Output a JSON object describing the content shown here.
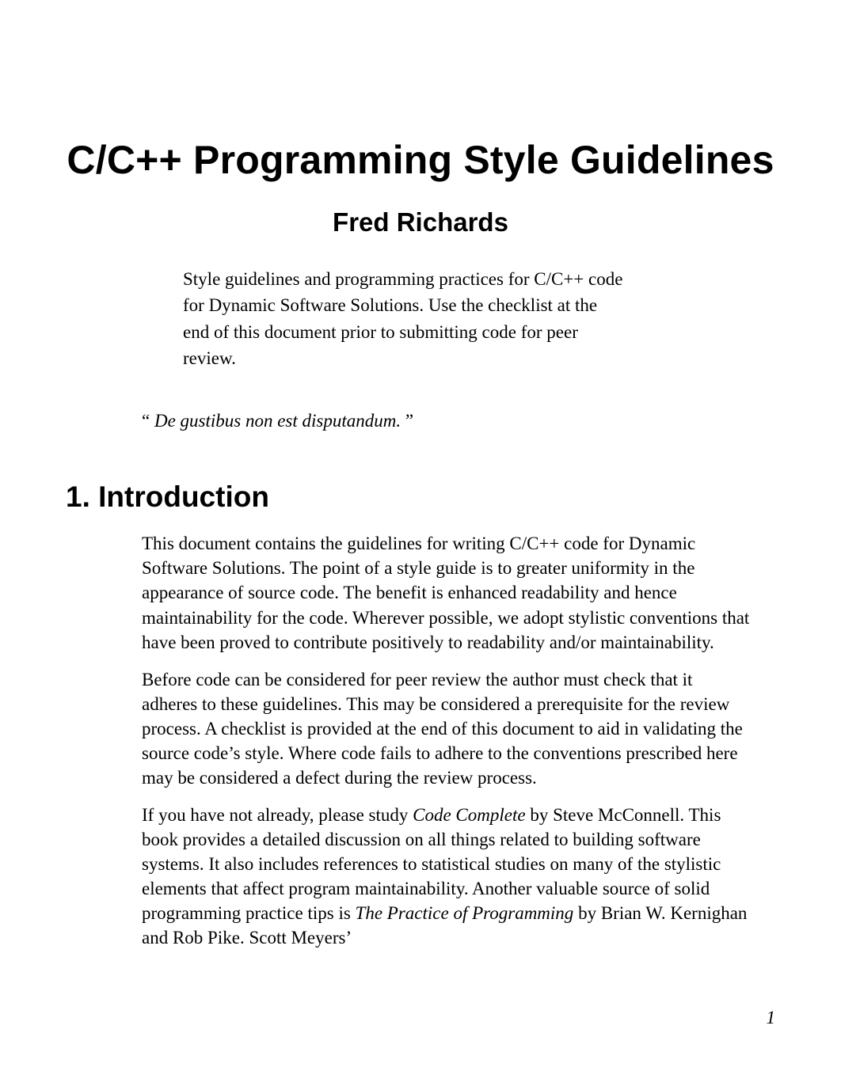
{
  "title": "C/C++ Programming Style Guidelines",
  "author": "Fred Richards",
  "abstract": "Style guidelines and programming practices for C/C++ code for Dynamic Software Solutions. Use the checklist at the end of this document prior to submitting code for peer review.",
  "quote": {
    "open": "“",
    "text": " De gustibus non est disputandum. ",
    "close": "”"
  },
  "section1_heading": "1. Introduction",
  "p1": "This document contains the guidelines for writing C/C++ code for Dynamic Software Solutions. The point of a style guide is to greater uniformity in the appearance of source code. The benefit is enhanced readability and hence maintainability for the code. Wherever possible, we adopt stylistic conventions that have been proved to contribute positively to readability and/or maintainability.",
  "p2": "Before code can be considered for peer review the author must check that it adheres to these guidelines. This may be considered a prerequisite for the review process. A checklist is provided at the end of this document to aid in validating the source code’s style. Where code fails to adhere to the conventions prescribed here may be considered a defect during the review process.",
  "p3_a": "If you have not already, please study ",
  "p3_i1": "Code Complete",
  "p3_b": " by Steve McConnell. This book provides a detailed discussion on all things related to building software systems. It also includes references to statistical studies on many of the stylistic elements that affect program maintainability. Another valuable source of solid programming practice tips is ",
  "p3_i2": "The Practice of Programming",
  "p3_c": " by Brian W. Kernighan and Rob Pike. Scott Meyers’",
  "page_number": "1"
}
